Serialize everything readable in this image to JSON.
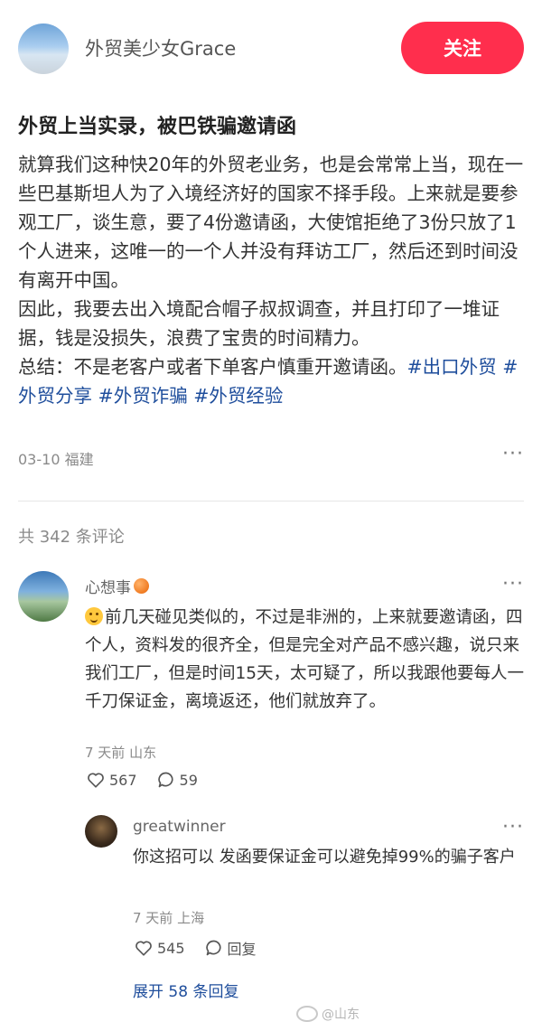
{
  "author": {
    "name": "外贸美少女Grace",
    "follow_label": "关注"
  },
  "post": {
    "title": "外贸上当实录，被巴铁骗邀请函",
    "paragraphs": [
      "就算我们这种快20年的外贸老业务，也是会常常上当，现在一些巴基斯坦人为了入境经济好的国家不择手段。上来就是要参观工厂，谈生意，要了4份邀请函，大使馆拒绝了3份只放了1个人进来，这唯一的一个人并没有拜访工厂，然后还到时间没有离开中国。",
      "因此，我要去出入境配合帽子叔叔调查，并且打印了一堆证据，钱是没损失，浪费了宝贵的时间精力。"
    ],
    "summary": "总结：不是老客户或者下单客户慎重开邀请函。",
    "tags": [
      "#出口外贸",
      "#外贸分享",
      "#外贸诈骗",
      "#外贸经验"
    ],
    "meta": "03-10 福建",
    "more_label": "···"
  },
  "comments_header": "共 342 条评论",
  "comments": [
    {
      "name": "心想事",
      "text": "前几天碰见类似的，不过是非洲的，上来就要邀请函，四个人，资料发的很齐全，但是完全对产品不感兴趣，说只来我们工厂，但是时间15天，太可疑了，所以我跟他要每人一千刀保证金，离境返还，他们就放弃了。",
      "meta": "7 天前 山东",
      "likes": "567",
      "replies": "59",
      "more_label": "···"
    }
  ],
  "reply": {
    "name": "greatwinner",
    "text": "你这招可以 发函要保证金可以避免掉99%的骗子客户",
    "meta": "7 天前 上海",
    "likes": "545",
    "reply_label": "回复",
    "more_label": "···"
  },
  "expand_label": "展开 58 条回复",
  "watermark": "@山东",
  "colors": {
    "accent": "#ff2e4d",
    "link": "#1f4e9c"
  },
  "icons": [
    "heart-icon",
    "comment-icon",
    "more-icon",
    "peach-emoji-icon",
    "grin-emoji-icon",
    "weibo-logo-icon"
  ]
}
